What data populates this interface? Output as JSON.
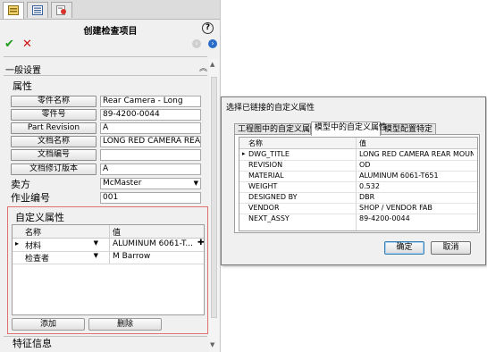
{
  "panel": {
    "title": "创建检查项目",
    "help_label": "?",
    "ok_label": "✔",
    "cancel_label": "✕",
    "back_label": "‹",
    "forward_label": "›",
    "section_general": "一般设置",
    "section_general_chevron": "︽",
    "properties_group": "属性",
    "fields": [
      {
        "label": "零件名称",
        "value": "Rear Camera - Long"
      },
      {
        "label": "零件号",
        "value": "89-4200-0044"
      },
      {
        "label": "Part Revision",
        "value": "A"
      },
      {
        "label": "文档名称",
        "value": "LONG RED CAMERA REAR MO"
      },
      {
        "label": "文档编号",
        "value": ""
      },
      {
        "label": "文档修订版本",
        "value": "A"
      }
    ],
    "vendor_label": "卖方",
    "vendor_value": "McMaster",
    "job_label": "作业编号",
    "job_value": "001",
    "custom_props": {
      "title": "自定义属性",
      "col_name": "名称",
      "col_value": "值",
      "rows": [
        {
          "name": "材料",
          "value": "ALUMINUM 6061-T...",
          "marker": "▸",
          "action": "✚"
        },
        {
          "name": "检查者",
          "value": "M Barrow",
          "marker": "",
          "action": ""
        }
      ],
      "add_label": "添加",
      "delete_label": "删除"
    },
    "section_features": "特征信息"
  },
  "dialog": {
    "title": "选择已链接的自定义属性",
    "tabs": [
      "工程图中的自定义属性",
      "模型中的自定义属性",
      "模型配置特定"
    ],
    "active_tab": 1,
    "col_name": "名称",
    "col_value": "值",
    "rows": [
      {
        "name": "DWG_TITLE",
        "value": "LONG RED CAMERA REAR MOUNTI...",
        "marker": "▸"
      },
      {
        "name": "REVISION",
        "value": "OD",
        "marker": ""
      },
      {
        "name": "MATERIAL",
        "value": "ALUMINUM 6061-T651",
        "marker": ""
      },
      {
        "name": "WEIGHT",
        "value": "0.532",
        "marker": ""
      },
      {
        "name": "DESIGNED BY",
        "value": "DBR",
        "marker": ""
      },
      {
        "name": "VENDOR",
        "value": "SHOP / VENDOR FAB",
        "marker": ""
      },
      {
        "name": "NEXT_ASSY",
        "value": "89-4200-0044",
        "marker": ""
      }
    ],
    "ok_label": "确定",
    "cancel_label": "取消"
  },
  "colors": {
    "ok": "#1a9b1a",
    "cancel": "#d01010",
    "custom_border": "#e2706f",
    "nav_active": "#2a6cc7"
  }
}
